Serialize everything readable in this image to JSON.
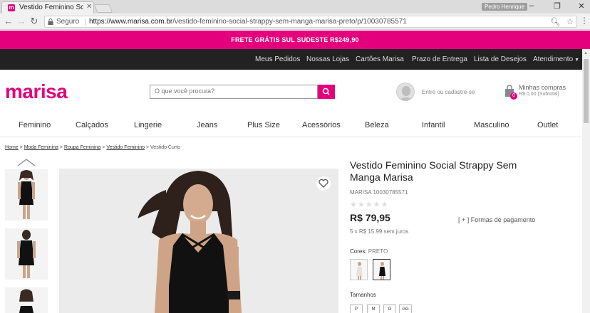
{
  "browser": {
    "tab_title": "Vestido Feminino Social S",
    "favicon_letter": "m",
    "profile_name": "Pedro Henrique",
    "secure_label": "Seguro",
    "url_host": "https://www.marisa.com.br",
    "url_path": "/vestido-feminino-social-strappy-sem-manga-marisa-preto/p/10030785571"
  },
  "promo": {
    "text": "FRETE GRÁTIS SUL SUDESTE R$249,90"
  },
  "top_nav": {
    "items": [
      "Meus Pedidos",
      "Nossas Lojas",
      "Cartões Marisa",
      "Prazo de Entrega",
      "Lista de Desejos",
      "Atendimento"
    ]
  },
  "header": {
    "logo": "marisa",
    "search_placeholder": "O que você procura?",
    "login_text": "Entre ou cadastre-se",
    "cart_title": "Minhas compras",
    "cart_subtotal": "R$ 0,00 (Subtotal)",
    "cart_count": "0"
  },
  "category_nav": {
    "items": [
      "Feminino",
      "Calçados",
      "Lingerie",
      "Jeans",
      "Plus Size",
      "Acessórios",
      "Beleza",
      "Infantil",
      "Masculino",
      "Outlet"
    ]
  },
  "breadcrumb": {
    "items": [
      "Home",
      "Moda Feminina",
      "Roupa Feminina",
      "Vestido Feminino"
    ],
    "current": "Vestido Curto",
    "separator": ">"
  },
  "product": {
    "title": "Vestido Feminino Social Strappy Sem Manga Marisa",
    "sku": "MARISA 10030785571",
    "price": "R$ 79,95",
    "payment_link": "[ + ] Formas de pagamento",
    "installments": "5 x R$ 15.99 sem juros",
    "colors_label": "Cores:",
    "selected_color": "PRETO",
    "sizes_label": "Tamanhos",
    "sizes": [
      "P",
      "M",
      "G",
      "GG"
    ],
    "rating_stars": "★★★★★"
  },
  "colors": {
    "accent": "#e4007c",
    "dark_nav": "#222222"
  }
}
